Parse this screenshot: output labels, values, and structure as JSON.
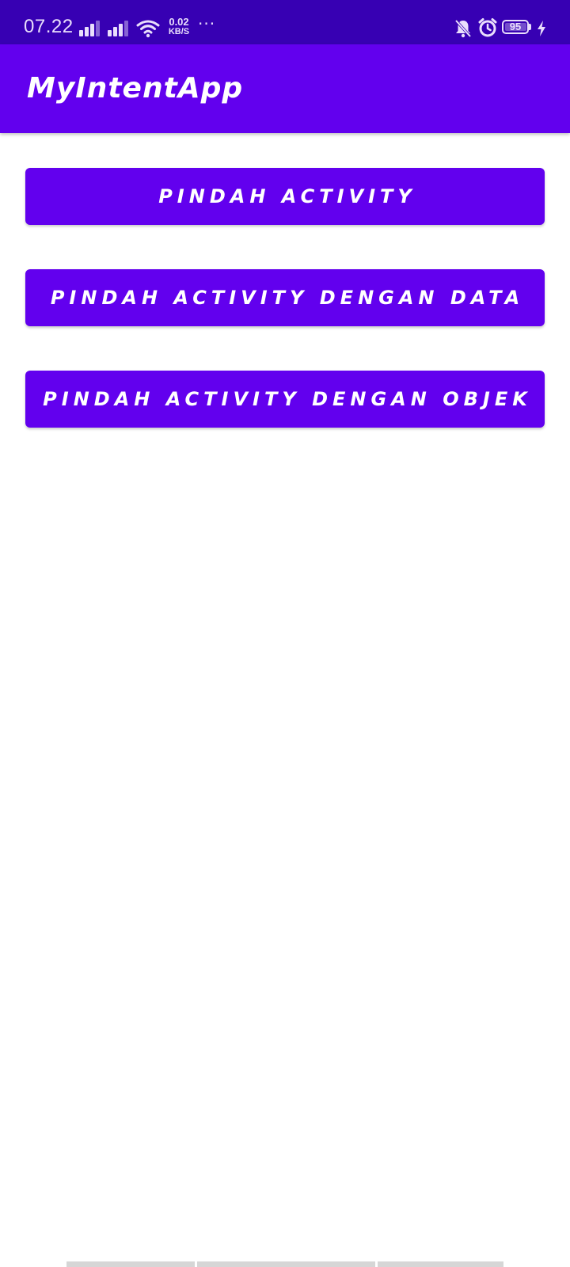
{
  "status_bar": {
    "time": "07.22",
    "net_speed_value": "0.02",
    "net_speed_unit": "KB/S",
    "more_dots": "···",
    "battery_level": "95",
    "icons": [
      "signal-icon",
      "signal-icon",
      "wifi-icon",
      "bell-off-icon",
      "alarm-icon",
      "battery-icon",
      "charging-bolt-icon"
    ]
  },
  "app_bar": {
    "title": "MyIntentApp"
  },
  "buttons": [
    {
      "label": "PINDAH ACTIVITY"
    },
    {
      "label": "PINDAH ACTIVITY DENGAN DATA"
    },
    {
      "label": "PINDAH ACTIVITY DENGAN OBJEK"
    }
  ],
  "colors": {
    "status_bar": "#3700B3",
    "primary": "#6200EE",
    "background": "#FFFFFF",
    "on_primary": "#FFFFFF"
  }
}
